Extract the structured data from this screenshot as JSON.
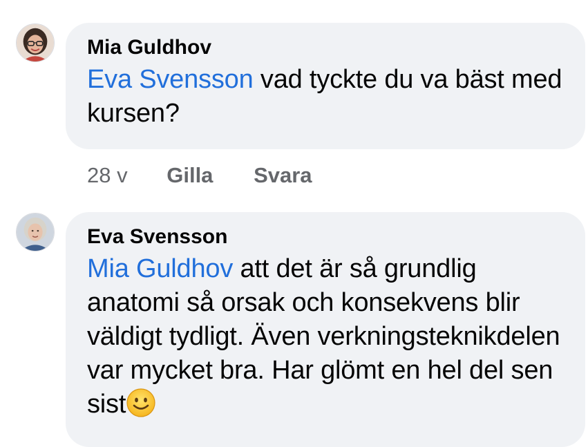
{
  "comments": [
    {
      "author": "Mia Guldhov",
      "mention": "Eva Svensson",
      "text": " vad tyckte du va bäst med kursen?",
      "avatar_icon": "user-avatar-woman-glasses-icon",
      "actions": {
        "time": "28 v",
        "like": "Gilla",
        "reply": "Svara"
      }
    },
    {
      "author": "Eva Svensson",
      "mention": "Mia Guldhov",
      "text": " att det är så grundlig anatomi så orsak och konsekvens blir väldigt tydligt. Även verkningsteknikdelen var mycket bra. Har glömt en hel del sen sist",
      "emoji_icon": "smiling-face-emoji-icon",
      "avatar_icon": "user-avatar-woman-gray-hair-icon"
    }
  ],
  "colors": {
    "bubble": "#f0f2f5",
    "mention": "#216fdb",
    "secondary_text": "#65676b",
    "primary_text": "#050505"
  }
}
